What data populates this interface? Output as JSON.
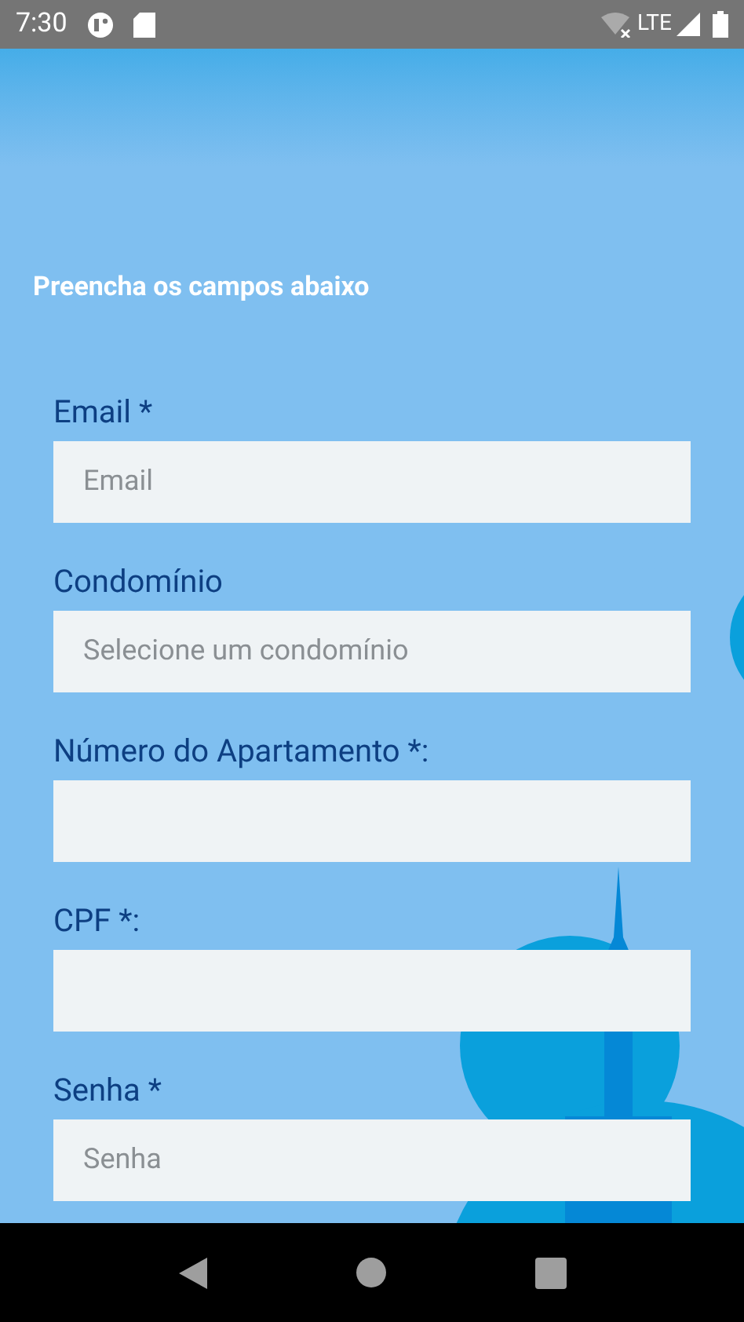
{
  "status_bar": {
    "time": "7:30",
    "network": "LTE"
  },
  "heading": "Preencha os campos abaixo",
  "fields": [
    {
      "label": "Email *",
      "placeholder": "Email"
    },
    {
      "label": "Condomínio",
      "placeholder": "Selecione um condomínio"
    },
    {
      "label": "Número do Apartamento *:"
    },
    {
      "label": "CPF *:"
    },
    {
      "label": "Senha *",
      "placeholder": "Senha"
    }
  ]
}
